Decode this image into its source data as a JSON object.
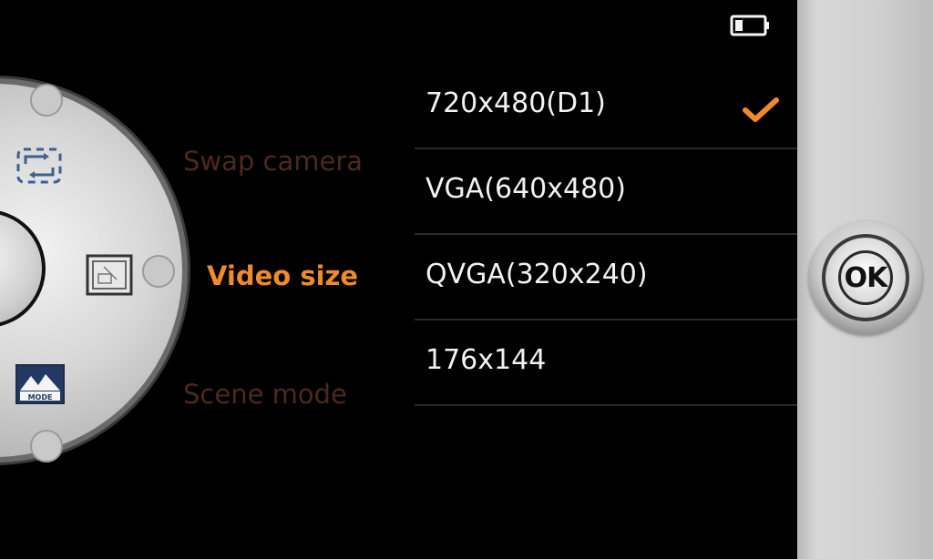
{
  "status": {
    "battery_icon": "battery-icon"
  },
  "dial": {
    "icons": [
      "swap-camera-icon",
      "video-size-icon",
      "scene-mode-icon"
    ],
    "scene_mode_icon_text": "MODE"
  },
  "menu": {
    "items": [
      {
        "label": "Swap camera",
        "state": "inactive"
      },
      {
        "label": "Video size",
        "state": "active"
      },
      {
        "label": "Scene mode",
        "state": "inactive"
      }
    ]
  },
  "options": {
    "items": [
      {
        "label": "720x480(D1)",
        "selected": true
      },
      {
        "label": "VGA(640x480)",
        "selected": false
      },
      {
        "label": "QVGA(320x240)",
        "selected": false
      },
      {
        "label": "176x144",
        "selected": false
      }
    ]
  },
  "ok_button": {
    "label": "OK"
  },
  "colors": {
    "accent": "#f08a2a",
    "inactive_menu": "#4a2a1c",
    "option_text": "#f2f2f2",
    "background": "#000000"
  }
}
